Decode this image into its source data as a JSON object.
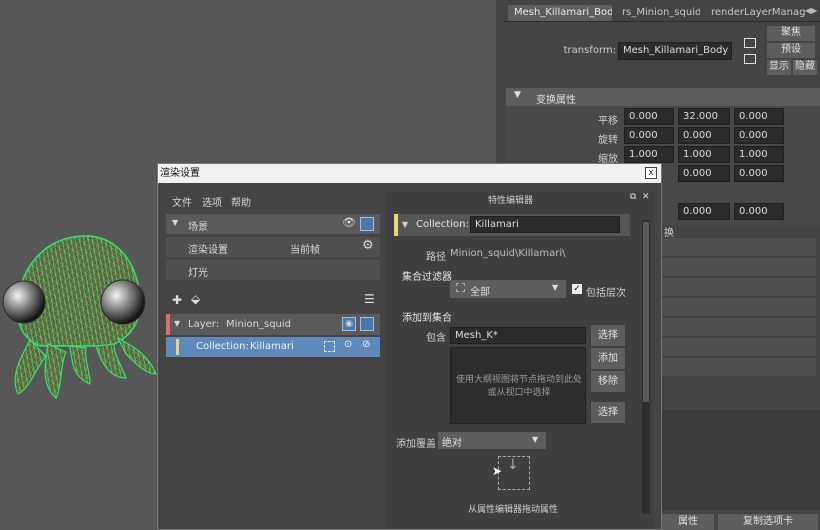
{
  "attribute_editor": {
    "tabs": [
      "Mesh_Killamari_Body",
      "rs_Minion_squid",
      "renderLayerManag"
    ],
    "transform_label": "transform:",
    "transform_value": "Mesh_Killamari_Body",
    "focus_btn": "聚焦",
    "preset_btn": "预设",
    "show_btn": "显示",
    "hide_btn": "隐藏",
    "section_title": "变换属性",
    "rows": [
      {
        "label": "平移",
        "values": [
          "0.000",
          "32.000",
          "0.000"
        ]
      },
      {
        "label": "旋转",
        "values": [
          "0.000",
          "0.000",
          "0.000"
        ]
      },
      {
        "label": "缩放",
        "values": [
          "1.000",
          "1.000",
          "1.000"
        ]
      },
      {
        "label": "",
        "values": [
          "0.000",
          "0.000",
          "0.000"
        ]
      },
      {
        "label": "",
        "values": [
          "0.000",
          "0.000",
          "0.000"
        ]
      }
    ],
    "partial_label": "换",
    "footer_btn_1": "属性",
    "footer_btn_2": "复制选项卡"
  },
  "render_setup": {
    "title": "渲染设置",
    "close_icon": "x",
    "menu": [
      "文件",
      "选项",
      "帮助"
    ],
    "scene": "场景",
    "render_settings": "渲染设置",
    "current_frame": "当前帧",
    "lights": "灯光",
    "layer_label": "Layer:",
    "layer_name": "Minion_squid",
    "collection_label": "Collection:",
    "collection_name": "Killamari",
    "property_editor": {
      "title": "特性编辑器",
      "collection_label": "Collection:",
      "collection_name": "Killamari",
      "path_label": "路径",
      "path_value": "Minion_squid\\Killamari\\",
      "filter_title": "集合过滤器",
      "filter_value": "全部",
      "include_hierarchy": "包括层次",
      "add_to_collection": "添加到集合",
      "include_label": "包含",
      "include_value": "Mesh_K*",
      "select_btn": "选择",
      "add_btn": "添加",
      "remove_btn": "移除",
      "select_btn_2": "选择",
      "drag_hint": "使用大纲视图将节点拖动到此处或从视口中选择",
      "add_override_label": "添加覆盖",
      "override_value": "绝对",
      "drag_attr_hint": "从属性编辑器拖动属性"
    }
  }
}
